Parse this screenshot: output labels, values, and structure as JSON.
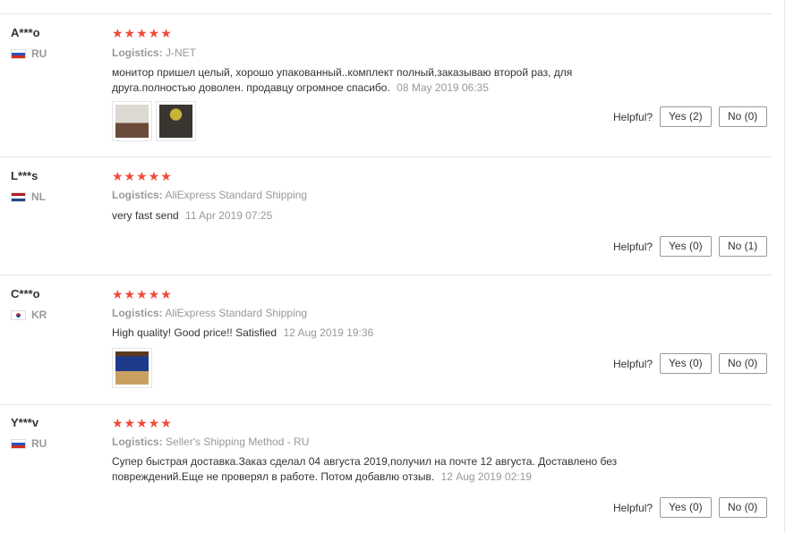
{
  "helpful_label": "Helpful?",
  "logistics_label": "Logistics:",
  "reviews": [
    {
      "user": "A***o",
      "country": "RU",
      "stars": "★★★★★",
      "logistics": "J-NET",
      "text": "монитор пришел целый, хорошо упакованный..комплект полный.заказываю второй раз, для друга.полностью доволен. продавцу огромное спасибо.",
      "date": "08 May 2019 06:35",
      "yes": "Yes (2)",
      "no": "No (0)"
    },
    {
      "user": "L***s",
      "country": "NL",
      "stars": "★★★★★",
      "logistics": "AliExpress Standard Shipping",
      "text": "very fast send",
      "date": "11 Apr 2019 07:25",
      "yes": "Yes (0)",
      "no": "No (1)"
    },
    {
      "user": "C***o",
      "country": "KR",
      "stars": "★★★★★",
      "logistics": "AliExpress Standard Shipping",
      "text": "High quality! Good price!! Satisfied",
      "date": "12 Aug 2019 19:36",
      "yes": "Yes (0)",
      "no": "No (0)"
    },
    {
      "user": "Y***v",
      "country": "RU",
      "stars": "★★★★★",
      "logistics": "Seller's Shipping Method - RU",
      "text": "Супер быстрая доставка.Заказ сделал 04 августа 2019,получил на почте 12 августа. Доставлено без повреждений.Еще не проверял в работе. Потом добавлю отзыв.",
      "date": "12 Aug 2019 02:19",
      "yes": "Yes (0)",
      "no": "No (0)"
    }
  ]
}
